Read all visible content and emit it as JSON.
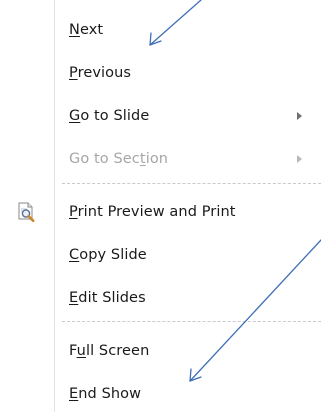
{
  "menu": {
    "items": [
      {
        "pre": "",
        "key": "N",
        "post": "ext",
        "disabled": false,
        "submenu": false
      },
      {
        "pre": "",
        "key": "P",
        "post": "revious",
        "disabled": false,
        "submenu": false
      },
      {
        "pre": "",
        "key": "G",
        "post": "o to Slide",
        "disabled": false,
        "submenu": true
      },
      {
        "pre": "Go to Sec",
        "key": "t",
        "post": "ion",
        "disabled": true,
        "submenu": true
      },
      {
        "pre": "",
        "key": "P",
        "post": "rint Preview and Print",
        "disabled": false,
        "submenu": false,
        "icon": "print-preview-icon"
      },
      {
        "pre": "",
        "key": "C",
        "post": "opy Slide",
        "disabled": false,
        "submenu": false
      },
      {
        "pre": "",
        "key": "E",
        "post": "dit Slides",
        "disabled": false,
        "submenu": false
      },
      {
        "pre": "F",
        "key": "u",
        "post": "ll Screen",
        "disabled": false,
        "submenu": false
      },
      {
        "pre": "",
        "key": "E",
        "post": "nd Show",
        "disabled": false,
        "submenu": false
      }
    ],
    "annotation_color": "#3f6fb6"
  }
}
